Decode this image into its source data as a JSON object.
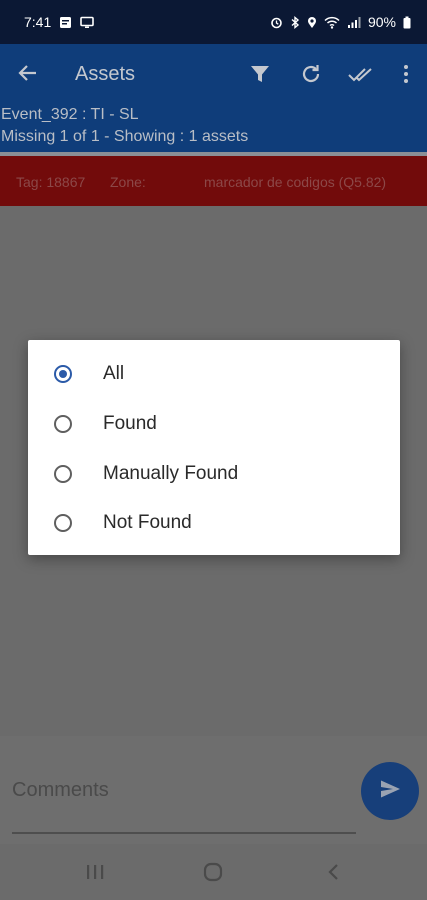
{
  "status_bar": {
    "time": "7:41",
    "battery": "90%",
    "left_icons": [
      "message-icon",
      "screen-cast-icon"
    ],
    "right_icons": [
      "alarm-icon",
      "bluetooth-icon",
      "location-icon",
      "wifi-icon",
      "signal-icon",
      "battery-icon"
    ]
  },
  "app_bar": {
    "title": "Assets",
    "actions": [
      "filter-icon",
      "refresh-icon",
      "done-all-icon",
      "more-vert-icon"
    ]
  },
  "info": {
    "line1": "Event_392 : TI - SL",
    "line2": "Missing 1 of 1   -   Showing : 1 assets"
  },
  "asset_row": {
    "tag": "Tag: 18867",
    "zone": "Zone:",
    "description": "marcador de codigos (Q5.82)"
  },
  "filter_dialog": {
    "options": [
      {
        "label": "All",
        "checked": true
      },
      {
        "label": "Found",
        "checked": false
      },
      {
        "label": "Manually Found",
        "checked": false
      },
      {
        "label": "Not Found",
        "checked": false
      }
    ]
  },
  "comments": {
    "placeholder": "Comments"
  },
  "colors": {
    "app_bar": "#0f3d7a",
    "status_bar": "#0b1834",
    "asset_row": "#720b0b",
    "radio_accent": "#2b5aa8",
    "scrim": "#6b6b6b"
  }
}
